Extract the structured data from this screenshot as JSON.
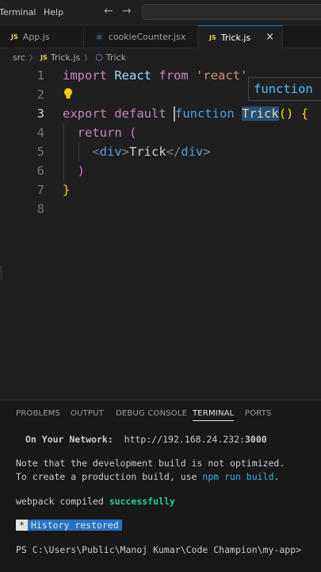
{
  "menu": {
    "terminal": "Terminal",
    "help": "Help"
  },
  "nav": {
    "back": "←",
    "forward": "→"
  },
  "tabs": [
    {
      "icon": "JS",
      "label": "App.js"
    },
    {
      "icon": "⚛",
      "label": "cookieCounter.jsx"
    },
    {
      "icon": "JS",
      "label": "Trick.js",
      "close": "×"
    }
  ],
  "breadcrumb": {
    "folder": "src",
    "file_icon": "JS",
    "file": "Trick.js",
    "symbol_icon": "⬡",
    "symbol": "Trick",
    "sep": "〉"
  },
  "editor": {
    "line_numbers": [
      "1",
      "2",
      "3",
      "4",
      "5",
      "6",
      "7",
      "8"
    ],
    "hover_text": "function",
    "l1": {
      "kw": "import",
      "id": "React",
      "kw2": "from",
      "str": "'react'"
    },
    "l3": {
      "kw": "export",
      "kw2": "default",
      "fnkw": "function",
      "name": "Trick",
      "parens": "()",
      "brace": "{"
    },
    "l4": {
      "kw": "return",
      "paren": "("
    },
    "l5": {
      "open_lt": "<",
      "open_tag": "div",
      "open_gt": ">",
      "text": "Trick",
      "close_lt": "</",
      "close_tag": "div",
      "close_gt": ">"
    },
    "l6": {
      "paren": ")"
    },
    "l7": {
      "brace": "}"
    }
  },
  "panel": {
    "tabs": [
      "PROBLEMS",
      "OUTPUT",
      "DEBUG CONSOLE",
      "TERMINAL",
      "PORTS"
    ],
    "terminal": {
      "network_label": "On Your Network:",
      "network_url_prefix": "http://192.168.24.232:",
      "network_port": "3000",
      "note1": "Note that the development build is not optimized.",
      "note2_prefix": "To create a production build, use ",
      "note2_cmd": "npm run build",
      "note2_suffix": ".",
      "compiled_prefix": "webpack compiled ",
      "compiled_status": "successfully",
      "history_star": "*",
      "history_text": "History restored",
      "prompt": "PS C:\\Users\\Public\\Manoj Kumar\\Code Champion\\my-app>"
    }
  }
}
